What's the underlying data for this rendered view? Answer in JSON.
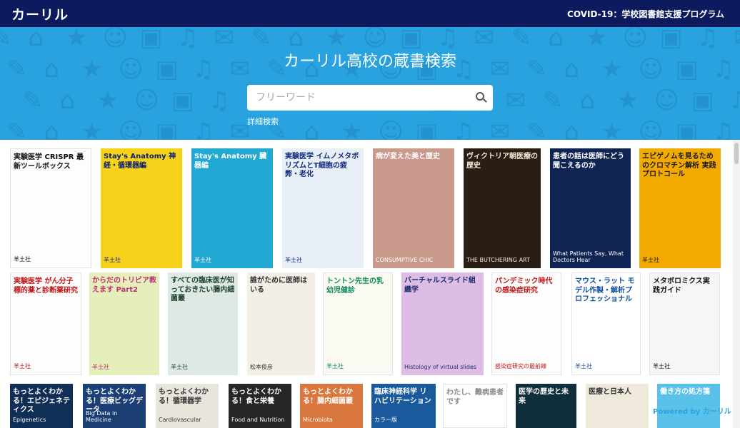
{
  "header": {
    "logo": "カーリル",
    "program_link": "COVID-19：学校図書館支援プログラム"
  },
  "hero": {
    "title": "カーリル高校の蔵書検索",
    "search_placeholder": "フリーワード",
    "advanced_search": "詳細検索"
  },
  "books": [
    {
      "title": "実験医学 CRISPR 最新ツールボックス",
      "subtitle": "羊土社"
    },
    {
      "title": "Stay's Anatomy 神経・循環器編",
      "subtitle": "羊土社"
    },
    {
      "title": "Stay's Anatomy 臓器編",
      "subtitle": "羊土社"
    },
    {
      "title": "実験医学 イムノメタボリズムとT細胞の疲弊・老化",
      "subtitle": "羊土社"
    },
    {
      "title": "病が変えた美と歴史",
      "subtitle": "CONSUMPTIVE CHIC"
    },
    {
      "title": "ヴィクトリア朝医療の歴史",
      "subtitle": "THE BUTCHERING ART"
    },
    {
      "title": "患者の話は医師にどう聞こえるのか",
      "subtitle": "What Patients Say, What Doctors Hear"
    },
    {
      "title": "エピゲノムを見るためのクロマチン解析 実践プロトコール",
      "subtitle": "羊土社"
    },
    {
      "title": "実験医学 がん分子標的薬と診断薬研究",
      "subtitle": "羊土社"
    },
    {
      "title": "からだのトリビア教えます Part2",
      "subtitle": "羊土社"
    },
    {
      "title": "すべての臨床医が知っておきたい腸内細菌叢",
      "subtitle": "羊土社"
    },
    {
      "title": "誰がために医師はいる",
      "subtitle": "松本俊彦"
    },
    {
      "title": "トントン先生の乳幼児健診",
      "subtitle": "羊土社"
    },
    {
      "title": "バーチャルスライド組織学",
      "subtitle": "Histology of virtual slides"
    },
    {
      "title": "パンデミック時代の感染症研究",
      "subtitle": "感染症研究の最前線"
    },
    {
      "title": "マウス・ラット モデル作製・解析プロフェッショナル",
      "subtitle": "羊土社"
    },
    {
      "title": "メタボロミクス実践ガイド",
      "subtitle": "羊土社"
    },
    {
      "title": "もっとよくわかる！エピジェネティクス",
      "subtitle": "Epigenetics"
    },
    {
      "title": "もっとよくわかる！医療ビッグデータ",
      "subtitle": "Big Data in Medicine"
    },
    {
      "title": "もっとよくわかる！循環器学",
      "subtitle": "Cardiovascular"
    },
    {
      "title": "もっとよくわかる！食と栄養",
      "subtitle": "Food and Nutrition"
    },
    {
      "title": "もっとよくわかる！腸内細菌叢",
      "subtitle": "Microbiota"
    },
    {
      "title": "臨床神経科学 リハビリテーション",
      "subtitle": "カラー版"
    },
    {
      "title": "わたし、難病患者です",
      "subtitle": ""
    },
    {
      "title": "医学の歴史と未来",
      "subtitle": ""
    },
    {
      "title": "医療と日本人",
      "subtitle": ""
    },
    {
      "title": "働き方の処方箋",
      "subtitle": ""
    }
  ],
  "footer_badge": "Powered by カーリル"
}
